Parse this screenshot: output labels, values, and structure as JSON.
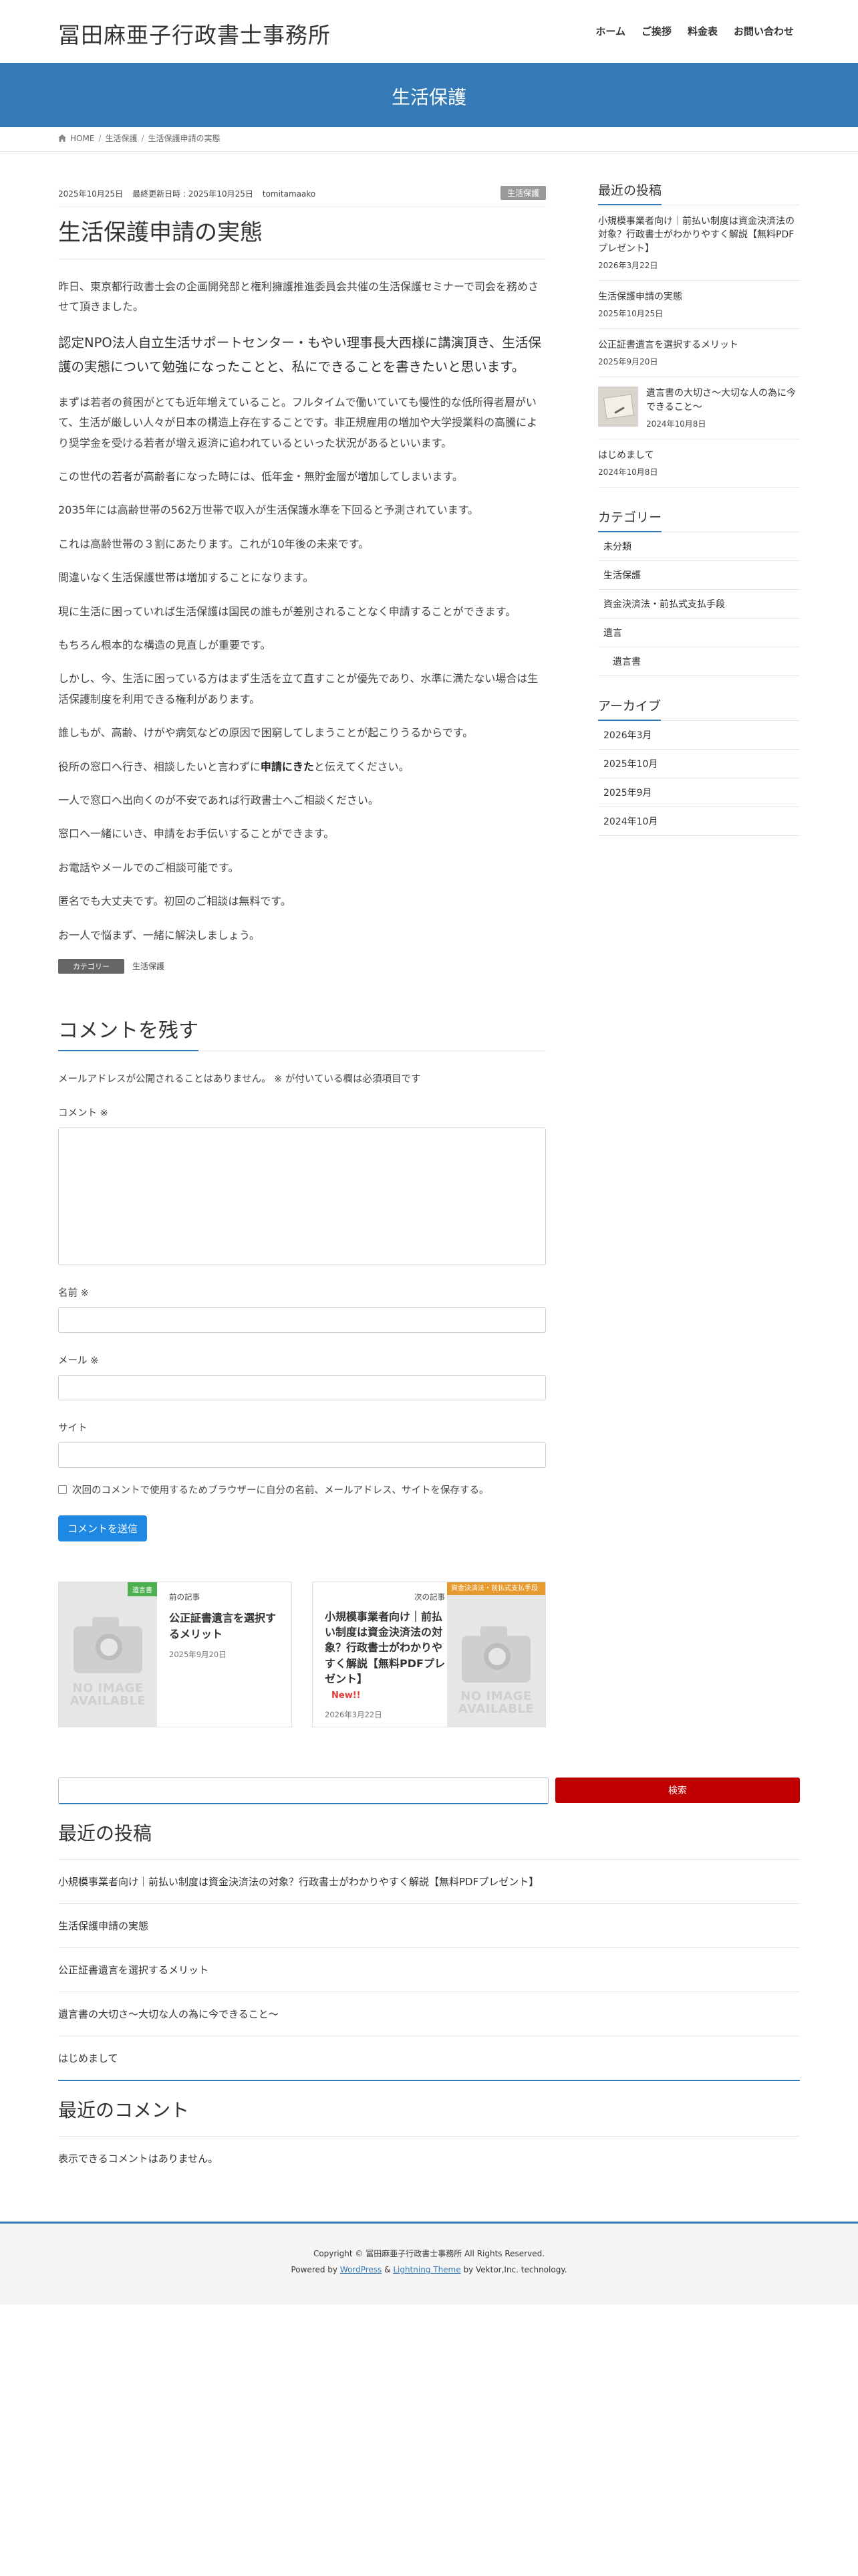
{
  "header": {
    "site_title": "冨田麻亜子行政書士事務所",
    "nav": [
      "ホーム",
      "ご挨拶",
      "料金表",
      "お問い合わせ"
    ]
  },
  "page_band": {
    "title": "生活保護"
  },
  "breadcrumb": {
    "home": "HOME",
    "category": "生活保護",
    "current": "生活保護申請の実態",
    "separator": "/"
  },
  "entry": {
    "published": "2025年10月25日",
    "updated": "最終更新日時 : 2025年10月25日",
    "author": "tomitamaako",
    "category_badge": "生活保護",
    "title": "生活保護申請の実態",
    "p1": "昨日、東京都行政書士会の企画開発部と権利擁護推進委員会共催の生活保護セミナーで司会を務めさせて頂きました。",
    "lead": "認定NPO法人自立生活サポートセンター・もやい理事長大西様に講演頂き、生活保護の実態について勉強になったことと、私にできることを書きたいと思います。",
    "p2": "まずは若者の貧困がとても近年増えていること。フルタイムで働いていても慢性的な低所得者層がいて、生活が厳しい人々が日本の構造上存在することです。非正規雇用の増加や大学授業料の高騰により奨学金を受ける若者が増え返済に追われているといった状況があるといいます。",
    "p3": "この世代の若者が高齢者になった時には、低年金・無貯金層が増加してしまいます。",
    "p4": "2035年には高齢世帯の562万世帯で収入が生活保護水準を下回ると予測されています。",
    "p5": "これは高齢世帯の３割にあたります。これが10年後の未来です。",
    "p6": "間違いなく生活保護世帯は増加することになります。",
    "p7": "現に生活に困っていれば生活保護は国民の誰もが差別されることなく申請することができます。",
    "p8": "もちろん根本的な構造の見直しが重要です。",
    "p9": "しかし、今、生活に困っている方はまず生活を立て直すことが優先であり、水準に満たない場合は生活保護制度を利用できる権利があります。",
    "p10": "誰しもが、高齢、けがや病気などの原因で困窮してしまうことが起こりうるからです。",
    "p11_a": "役所の窓口へ行き、相談したいと言わずに",
    "p11_b": "申請にきた",
    "p11_c": "と伝えてください。",
    "p12": "一人で窓口へ出向くのが不安であれば行政書士へご相談ください。",
    "p13": "窓口へ一緒にいき、申請をお手伝いすることができます。",
    "p14": "お電話やメールでのご相談可能です。",
    "p15": "匿名でも大丈夫です。初回のご相談は無料です。",
    "p16": "お一人で悩まず、一緒に解決しましょう。",
    "category_label": "カテゴリー",
    "category_value": "生活保護"
  },
  "comment_form": {
    "heading": "コメントを残す",
    "notes": "メールアドレスが公開されることはありません。 ※ が付いている欄は必須項目です",
    "comment_label": "コメント ※",
    "name_label": "名前 ※",
    "email_label": "メール ※",
    "site_label": "サイト",
    "save_label": "次回のコメントで使用するためブラウザーに自分の名前、メールアドレス、サイトを保存する。",
    "submit_label": "コメントを送信"
  },
  "post_nav": {
    "prev": {
      "kind": "前の記事",
      "tag": "遺言書",
      "title": "公正証書遺言を選択するメリット",
      "date": "2025年9月20日"
    },
    "next": {
      "kind": "次の記事",
      "tag": "資金決済法・前払式支払手段",
      "title": "小規模事業者向け｜前払い制度は資金決済法の対象？行政書士がわかりやすく解説【無料PDFプレゼント】",
      "new": "New!!",
      "date": "2026年3月22日"
    },
    "noimage_text": "NO IMAGE AVAILABLE"
  },
  "sidebar": {
    "recent_heading": "最近の投稿",
    "recent_posts": [
      {
        "title": "小規模事業者向け｜前払い制度は資金決済法の対象？行政書士がわかりやすく解説【無料PDFプレゼント】",
        "date": "2026年3月22日"
      },
      {
        "title": "生活保護申請の実態",
        "date": "2025年10月25日"
      },
      {
        "title": "公正証書遺言を選択するメリット",
        "date": "2025年9月20日"
      },
      {
        "title": "遺言書の大切さ〜大切な人の為に今できること〜",
        "date": "2024年10月8日"
      },
      {
        "title": "はじめまして",
        "date": "2024年10月8日"
      }
    ],
    "category_heading": "カテゴリー",
    "categories": [
      "未分類",
      "生活保護",
      "資金決済法・前払式支払手段",
      "遺言",
      "遺言書"
    ],
    "archive_heading": "アーカイブ",
    "archives": [
      "2026年3月",
      "2025年10月",
      "2025年9月",
      "2024年10月"
    ]
  },
  "footer_widgets": {
    "search_button": "検索",
    "recent_heading": "最近の投稿",
    "recent_items": [
      "小規模事業者向け｜前払い制度は資金決済法の対象？行政書士がわかりやすく解説【無料PDFプレゼント】",
      "生活保護申請の実態",
      "公正証書遺言を選択するメリット",
      "遺言書の大切さ〜大切な人の為に今できること〜",
      "はじめまして"
    ],
    "comments_heading": "最近のコメント",
    "no_comments": "表示できるコメントはありません。"
  },
  "footer": {
    "copyright": "Copyright © 冨田麻亜子行政書士事務所 All Rights Reserved.",
    "powered_prefix": "Powered by",
    "wordpress": "WordPress",
    "amp": "&",
    "theme": "Lightning Theme",
    "by": "by Vektor,Inc. technology."
  },
  "colors": {
    "accent": "#337ab7",
    "search_button": "#c00000",
    "submit_button": "#1e88e5",
    "tag_green": "#4caf50",
    "tag_orange": "#e79a2d",
    "new_red": "#e53935"
  }
}
